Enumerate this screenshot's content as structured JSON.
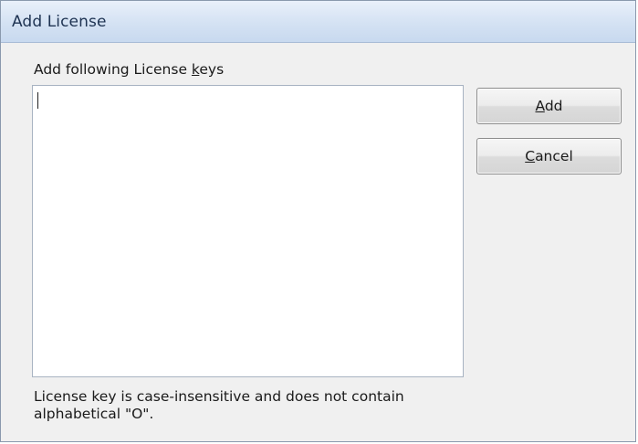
{
  "window": {
    "title": "Add License"
  },
  "form": {
    "keys_label_prefix": "Add following License ",
    "keys_label_mnemonic": "k",
    "keys_label_suffix": "eys",
    "keys_value": "",
    "note_line1": "License key is case-insensitive and does not contain",
    "note_line2": "alphabetical \"O\"."
  },
  "buttons": {
    "add_mnemonic": "A",
    "add_rest": "dd",
    "cancel_mnemonic": "C",
    "cancel_rest": "ancel"
  }
}
